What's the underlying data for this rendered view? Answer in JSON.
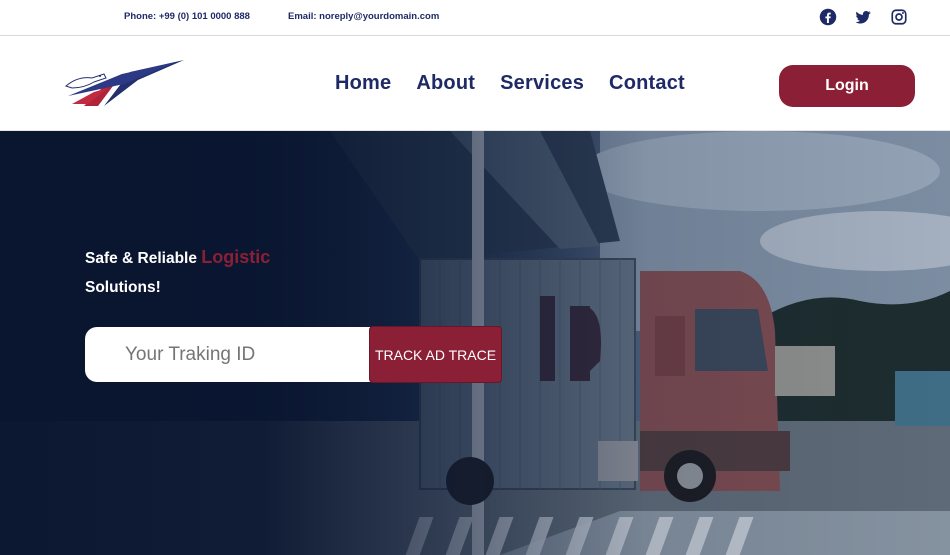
{
  "topbar": {
    "phone": "Phone: +99 (0) 101 0000 888",
    "email": "Email: noreply@yourdomain.com",
    "social": [
      "facebook-icon",
      "twitter-icon",
      "instagram-icon"
    ]
  },
  "header": {
    "nav": [
      "Home",
      "About",
      "Services",
      "Contact"
    ],
    "login_label": "Login"
  },
  "hero": {
    "tagline_part1": "Safe & Reliable ",
    "tagline_accent": "Logistic",
    "tagline_part2": "Solutions!",
    "track_placeholder": "Your Traking ID",
    "track_button": "TRACK AD TRACE"
  },
  "colors": {
    "brand_navy": "#1e2a66",
    "brand_maroon": "#8b1f36",
    "hero_dark": "#0c1a36"
  }
}
